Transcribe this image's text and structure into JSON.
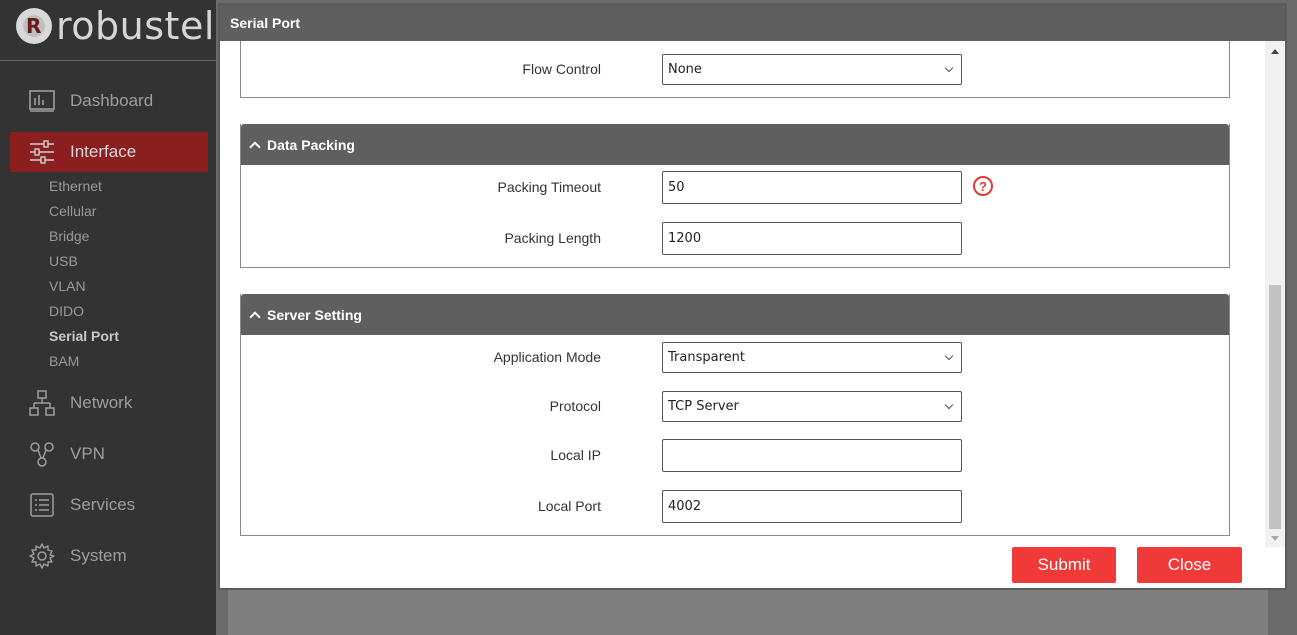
{
  "brand": {
    "logo_text": "robustel"
  },
  "sidebar": {
    "items": [
      {
        "label": "Dashboard",
        "icon": "dashboard-icon"
      },
      {
        "label": "Interface",
        "icon": "sliders-icon",
        "active": true
      },
      {
        "label": "Network",
        "icon": "network-icon"
      },
      {
        "label": "VPN",
        "icon": "vpn-icon"
      },
      {
        "label": "Services",
        "icon": "services-icon"
      },
      {
        "label": "System",
        "icon": "gear-icon"
      }
    ],
    "sub_items": [
      "Ethernet",
      "Cellular",
      "Bridge",
      "USB",
      "VLAN",
      "DIDO",
      "Serial Port",
      "BAM"
    ],
    "active_sub_item": "Serial Port"
  },
  "modal": {
    "title": "Serial Port",
    "flow_control": {
      "label": "Flow Control",
      "value": "None"
    },
    "data_packing": {
      "title": "Data Packing",
      "packing_timeout": {
        "label": "Packing Timeout",
        "value": "50"
      },
      "packing_length": {
        "label": "Packing Length",
        "value": "1200"
      }
    },
    "server_setting": {
      "title": "Server Setting",
      "application_mode": {
        "label": "Application Mode",
        "value": "Transparent"
      },
      "protocol": {
        "label": "Protocol",
        "value": "TCP Server"
      },
      "local_ip": {
        "label": "Local IP",
        "value": ""
      },
      "local_port": {
        "label": "Local Port",
        "value": "4002"
      }
    },
    "submit_label": "Submit",
    "close_label": "Close"
  },
  "colors": {
    "accent": "#f03a3a",
    "sidebar_bg": "#333333",
    "active_nav": "#8b1f1f",
    "header_bg": "#5f5f5f"
  }
}
